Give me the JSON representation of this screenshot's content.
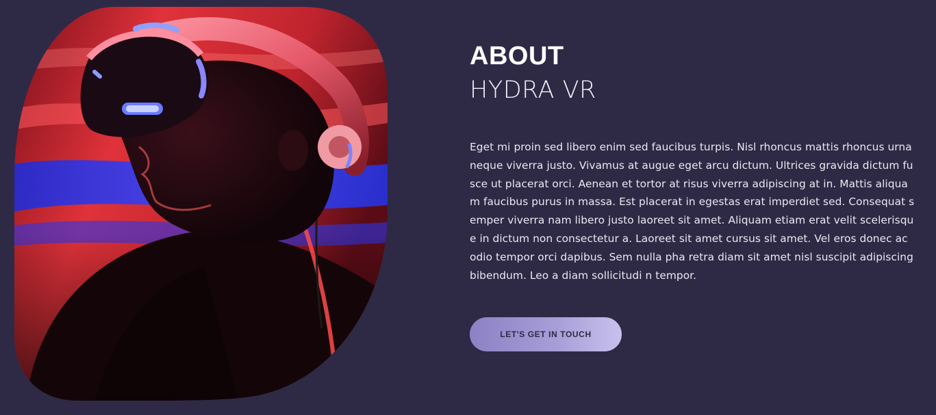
{
  "about": {
    "title": "ABOUT",
    "subtitle": "HYDRA VR",
    "body": "Eget mi proin sed libero enim sed faucibus turpis. Nisl rhoncus mattis rhoncus urna neque viverra justo. Vivamus at augue eget arcu dictum. Ultrices gravida dictum fusce ut placerat orci. Aenean et tortor at risus viverra adipiscing at in. Mattis aliquam faucibus purus in massa. Est placerat in egestas erat imperdiet sed. Consequat semper viverra nam libero justo laoreet sit amet. Aliquam etiam erat velit scelerisque in dictum non consectetur a. Laoreet sit amet cursus sit amet. Vel eros donec ac odio tempor orci dapibus. Sem nulla pha retra diam sit amet nisl suscipit adipiscing bibendum. Leo a diam sollicitudi n tempor.",
    "cta_label": "LET'S GET IN TOUCH"
  },
  "image": {
    "subject": "person-wearing-vr-headset"
  },
  "colors": {
    "background": "#2e2a45",
    "accent_start": "#8c82c4",
    "accent_end": "#c8c1ec",
    "heading": "#ffffff",
    "body_text": "#eae9f2",
    "button_text": "#2e2a45"
  }
}
